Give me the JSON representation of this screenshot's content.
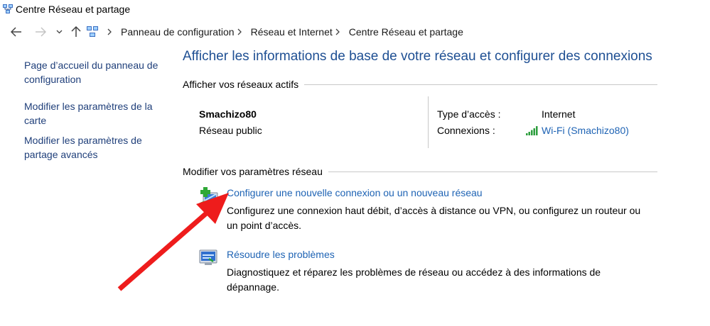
{
  "window": {
    "title": "Centre Réseau et partage"
  },
  "navigation": {
    "breadcrumb": [
      "Panneau de configuration",
      "Réseau et Internet",
      "Centre Réseau et partage"
    ]
  },
  "sidebar": {
    "items": [
      {
        "label": "Page d’accueil du panneau de configuration"
      },
      {
        "label": "Modifier les paramètres de la carte"
      },
      {
        "label": "Modifier les paramètres de partage avancés"
      }
    ]
  },
  "main": {
    "title": "Afficher les informations de base de votre réseau et configurer des connexions",
    "active_networks": {
      "heading": "Afficher vos réseaux actifs",
      "network_name": "Smachizo80",
      "network_category": "Réseau public",
      "access_type_label": "Type d’accès :",
      "access_type_value": "Internet",
      "connections_label": "Connexions :",
      "connections_value": "Wi-Fi (Smachizo80)"
    },
    "change_settings": {
      "heading": "Modifier vos paramètres réseau",
      "tasks": [
        {
          "link": "Configurer une nouvelle connexion ou un nouveau réseau",
          "description": "Configurez une connexion haut débit, d’accès à distance ou VPN, ou configurez un routeur ou un point d’accès.",
          "icon": "new-connection-icon"
        },
        {
          "link": "Résoudre les problèmes",
          "description": "Diagnostiquez et réparez les problèmes de réseau ou accédez à des informations de dépannage.",
          "icon": "troubleshoot-icon"
        }
      ]
    }
  },
  "colors": {
    "link": "#1e63b4",
    "title": "#1e4f93",
    "sidebar_link": "#1f3f7a",
    "annotation_arrow": "#ee1c1c"
  }
}
